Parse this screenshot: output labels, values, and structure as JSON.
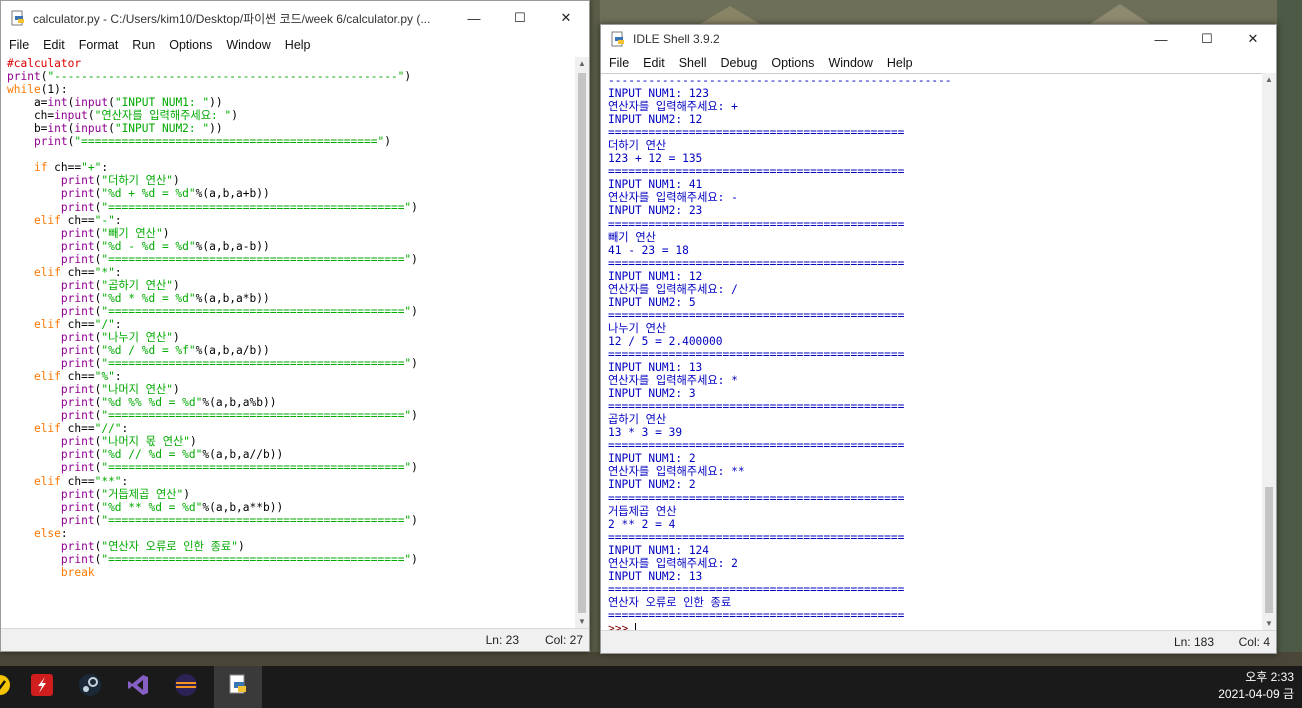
{
  "editor": {
    "title": "calculator.py - C:/Users/kim10/Desktop/파이썬 코드/week 6/calculator.py (...",
    "menu": [
      "File",
      "Edit",
      "Format",
      "Run",
      "Options",
      "Window",
      "Help"
    ],
    "status": {
      "line": "Ln: 23",
      "col": "Col: 27"
    },
    "code": [
      [
        [
          "c-com",
          "#calculator"
        ]
      ],
      [
        [
          "c-bi",
          "print"
        ],
        [
          "c-def",
          "("
        ],
        [
          "c-str",
          "\"---------------------------------------------------\""
        ],
        [
          "c-def",
          ")"
        ]
      ],
      [
        [
          "c-kw",
          "while"
        ],
        [
          "c-def",
          "(1):"
        ]
      ],
      [
        [
          "c-def",
          "    a="
        ],
        [
          "c-bi",
          "int"
        ],
        [
          "c-def",
          "("
        ],
        [
          "c-bi",
          "input"
        ],
        [
          "c-def",
          "("
        ],
        [
          "c-str",
          "\"INPUT NUM1: \""
        ],
        [
          "c-def",
          "))"
        ]
      ],
      [
        [
          "c-def",
          "    ch="
        ],
        [
          "c-bi",
          "input"
        ],
        [
          "c-def",
          "("
        ],
        [
          "c-str",
          "\"연산자를 입력해주세요: \""
        ],
        [
          "c-def",
          ")"
        ]
      ],
      [
        [
          "c-def",
          "    b="
        ],
        [
          "c-bi",
          "int"
        ],
        [
          "c-def",
          "("
        ],
        [
          "c-bi",
          "input"
        ],
        [
          "c-def",
          "("
        ],
        [
          "c-str",
          "\"INPUT NUM2: \""
        ],
        [
          "c-def",
          "))"
        ]
      ],
      [
        [
          "c-def",
          "    "
        ],
        [
          "c-bi",
          "print"
        ],
        [
          "c-def",
          "("
        ],
        [
          "c-str",
          "\"============================================\""
        ],
        [
          "c-def",
          ")"
        ]
      ],
      [
        [
          "c-def",
          ""
        ]
      ],
      [
        [
          "c-def",
          "    "
        ],
        [
          "c-kw",
          "if"
        ],
        [
          "c-def",
          " ch=="
        ],
        [
          "c-str",
          "\"+\""
        ],
        [
          "c-def",
          ":"
        ]
      ],
      [
        [
          "c-def",
          "        "
        ],
        [
          "c-bi",
          "print"
        ],
        [
          "c-def",
          "("
        ],
        [
          "c-str",
          "\"더하기 연산\""
        ],
        [
          "c-def",
          ")"
        ]
      ],
      [
        [
          "c-def",
          "        "
        ],
        [
          "c-bi",
          "print"
        ],
        [
          "c-def",
          "("
        ],
        [
          "c-str",
          "\"%d + %d = %d\""
        ],
        [
          "c-def",
          "%(a,b,a+b))"
        ]
      ],
      [
        [
          "c-def",
          "        "
        ],
        [
          "c-bi",
          "print"
        ],
        [
          "c-def",
          "("
        ],
        [
          "c-str",
          "\"============================================\""
        ],
        [
          "c-def",
          ")"
        ]
      ],
      [
        [
          "c-def",
          "    "
        ],
        [
          "c-kw",
          "elif"
        ],
        [
          "c-def",
          " ch=="
        ],
        [
          "c-str",
          "\"-\""
        ],
        [
          "c-def",
          ":"
        ]
      ],
      [
        [
          "c-def",
          "        "
        ],
        [
          "c-bi",
          "print"
        ],
        [
          "c-def",
          "("
        ],
        [
          "c-str",
          "\"빼기 연산\""
        ],
        [
          "c-def",
          ")"
        ]
      ],
      [
        [
          "c-def",
          "        "
        ],
        [
          "c-bi",
          "print"
        ],
        [
          "c-def",
          "("
        ],
        [
          "c-str",
          "\"%d - %d = %d\""
        ],
        [
          "c-def",
          "%(a,b,a-b))"
        ]
      ],
      [
        [
          "c-def",
          "        "
        ],
        [
          "c-bi",
          "print"
        ],
        [
          "c-def",
          "("
        ],
        [
          "c-str",
          "\"============================================\""
        ],
        [
          "c-def",
          ")"
        ]
      ],
      [
        [
          "c-def",
          "    "
        ],
        [
          "c-kw",
          "elif"
        ],
        [
          "c-def",
          " ch=="
        ],
        [
          "c-str",
          "\"*\""
        ],
        [
          "c-def",
          ":"
        ]
      ],
      [
        [
          "c-def",
          "        "
        ],
        [
          "c-bi",
          "print"
        ],
        [
          "c-def",
          "("
        ],
        [
          "c-str",
          "\"곱하기 연산\""
        ],
        [
          "c-def",
          ")"
        ]
      ],
      [
        [
          "c-def",
          "        "
        ],
        [
          "c-bi",
          "print"
        ],
        [
          "c-def",
          "("
        ],
        [
          "c-str",
          "\"%d * %d = %d\""
        ],
        [
          "c-def",
          "%(a,b,a*b))"
        ]
      ],
      [
        [
          "c-def",
          "        "
        ],
        [
          "c-bi",
          "print"
        ],
        [
          "c-def",
          "("
        ],
        [
          "c-str",
          "\"============================================\""
        ],
        [
          "c-def",
          ")"
        ]
      ],
      [
        [
          "c-def",
          "    "
        ],
        [
          "c-kw",
          "elif"
        ],
        [
          "c-def",
          " ch=="
        ],
        [
          "c-str",
          "\"/\""
        ],
        [
          "c-def",
          ":"
        ]
      ],
      [
        [
          "c-def",
          "        "
        ],
        [
          "c-bi",
          "print"
        ],
        [
          "c-def",
          "("
        ],
        [
          "c-str",
          "\"나누기 연산\""
        ],
        [
          "c-def",
          ")"
        ]
      ],
      [
        [
          "c-def",
          "        "
        ],
        [
          "c-bi",
          "print"
        ],
        [
          "c-def",
          "("
        ],
        [
          "c-str",
          "\"%d / %d = %f\""
        ],
        [
          "c-def",
          "%(a,b,a/b))"
        ]
      ],
      [
        [
          "c-def",
          "        "
        ],
        [
          "c-bi",
          "print"
        ],
        [
          "c-def",
          "("
        ],
        [
          "c-str",
          "\"============================================\""
        ],
        [
          "c-def",
          ")"
        ]
      ],
      [
        [
          "c-def",
          "    "
        ],
        [
          "c-kw",
          "elif"
        ],
        [
          "c-def",
          " ch=="
        ],
        [
          "c-str",
          "\"%\""
        ],
        [
          "c-def",
          ":"
        ]
      ],
      [
        [
          "c-def",
          "        "
        ],
        [
          "c-bi",
          "print"
        ],
        [
          "c-def",
          "("
        ],
        [
          "c-str",
          "\"나머지 연산\""
        ],
        [
          "c-def",
          ")"
        ]
      ],
      [
        [
          "c-def",
          "        "
        ],
        [
          "c-bi",
          "print"
        ],
        [
          "c-def",
          "("
        ],
        [
          "c-str",
          "\"%d %% %d = %d\""
        ],
        [
          "c-def",
          "%(a,b,a%b))"
        ]
      ],
      [
        [
          "c-def",
          "        "
        ],
        [
          "c-bi",
          "print"
        ],
        [
          "c-def",
          "("
        ],
        [
          "c-str",
          "\"============================================\""
        ],
        [
          "c-def",
          ")"
        ]
      ],
      [
        [
          "c-def",
          "    "
        ],
        [
          "c-kw",
          "elif"
        ],
        [
          "c-def",
          " ch=="
        ],
        [
          "c-str",
          "\"//\""
        ],
        [
          "c-def",
          ":"
        ]
      ],
      [
        [
          "c-def",
          "        "
        ],
        [
          "c-bi",
          "print"
        ],
        [
          "c-def",
          "("
        ],
        [
          "c-str",
          "\"나머지 몫 연산\""
        ],
        [
          "c-def",
          ")"
        ]
      ],
      [
        [
          "c-def",
          "        "
        ],
        [
          "c-bi",
          "print"
        ],
        [
          "c-def",
          "("
        ],
        [
          "c-str",
          "\"%d // %d = %d\""
        ],
        [
          "c-def",
          "%(a,b,a//b))"
        ]
      ],
      [
        [
          "c-def",
          "        "
        ],
        [
          "c-bi",
          "print"
        ],
        [
          "c-def",
          "("
        ],
        [
          "c-str",
          "\"============================================\""
        ],
        [
          "c-def",
          ")"
        ]
      ],
      [
        [
          "c-def",
          "    "
        ],
        [
          "c-kw",
          "elif"
        ],
        [
          "c-def",
          " ch=="
        ],
        [
          "c-str",
          "\"**\""
        ],
        [
          "c-def",
          ":"
        ]
      ],
      [
        [
          "c-def",
          "        "
        ],
        [
          "c-bi",
          "print"
        ],
        [
          "c-def",
          "("
        ],
        [
          "c-str",
          "\"거듭제곱 연산\""
        ],
        [
          "c-def",
          ")"
        ]
      ],
      [
        [
          "c-def",
          "        "
        ],
        [
          "c-bi",
          "print"
        ],
        [
          "c-def",
          "("
        ],
        [
          "c-str",
          "\"%d ** %d = %d\""
        ],
        [
          "c-def",
          "%(a,b,a**b))"
        ]
      ],
      [
        [
          "c-def",
          "        "
        ],
        [
          "c-bi",
          "print"
        ],
        [
          "c-def",
          "("
        ],
        [
          "c-str",
          "\"============================================\""
        ],
        [
          "c-def",
          ")"
        ]
      ],
      [
        [
          "c-def",
          "    "
        ],
        [
          "c-kw",
          "else"
        ],
        [
          "c-def",
          ":"
        ]
      ],
      [
        [
          "c-def",
          "        "
        ],
        [
          "c-bi",
          "print"
        ],
        [
          "c-def",
          "("
        ],
        [
          "c-str",
          "\"연산자 오류로 인한 종료\""
        ],
        [
          "c-def",
          ")"
        ]
      ],
      [
        [
          "c-def",
          "        "
        ],
        [
          "c-bi",
          "print"
        ],
        [
          "c-def",
          "("
        ],
        [
          "c-str",
          "\"============================================\""
        ],
        [
          "c-def",
          ")"
        ]
      ],
      [
        [
          "c-def",
          "        "
        ],
        [
          "c-kw",
          "break"
        ]
      ]
    ]
  },
  "shell": {
    "title": "IDLE Shell 3.9.2",
    "menu": [
      "File",
      "Edit",
      "Shell",
      "Debug",
      "Options",
      "Window",
      "Help"
    ],
    "status": {
      "line": "Ln: 183",
      "col": "Col: 4"
    },
    "prompt": ">>> ",
    "output": [
      "---------------------------------------------------",
      "INPUT NUM1: 123",
      "연산자를 입력해주세요: +",
      "INPUT NUM2: 12",
      "============================================",
      "더하기 연산",
      "123 + 12 = 135",
      "============================================",
      "INPUT NUM1: 41",
      "연산자를 입력해주세요: -",
      "INPUT NUM2: 23",
      "============================================",
      "빼기 연산",
      "41 - 23 = 18",
      "============================================",
      "INPUT NUM1: 12",
      "연산자를 입력해주세요: /",
      "INPUT NUM2: 5",
      "============================================",
      "나누기 연산",
      "12 / 5 = 2.400000",
      "============================================",
      "INPUT NUM1: 13",
      "연산자를 입력해주세요: *",
      "INPUT NUM2: 3",
      "============================================",
      "곱하기 연산",
      "13 * 3 = 39",
      "============================================",
      "INPUT NUM1: 2",
      "연산자를 입력해주세요: **",
      "INPUT NUM2: 2",
      "============================================",
      "거듭제곱 연산",
      "2 ** 2 = 4",
      "============================================",
      "INPUT NUM1: 124",
      "연산자를 입력해주세요: 2",
      "INPUT NUM2: 13",
      "============================================",
      "연산자 오류로 인한 종료",
      "============================================"
    ]
  },
  "taskbar": {
    "icons": [
      "norton-icon",
      "flash-icon",
      "steam-icon",
      "visual-studio-icon",
      "eclipse-icon",
      "python-idle-icon"
    ],
    "time": "오후 2:33",
    "date": "2021-04-09 금"
  },
  "window_controls": {
    "minimize": "—",
    "maximize": "☐",
    "close": "✕"
  }
}
